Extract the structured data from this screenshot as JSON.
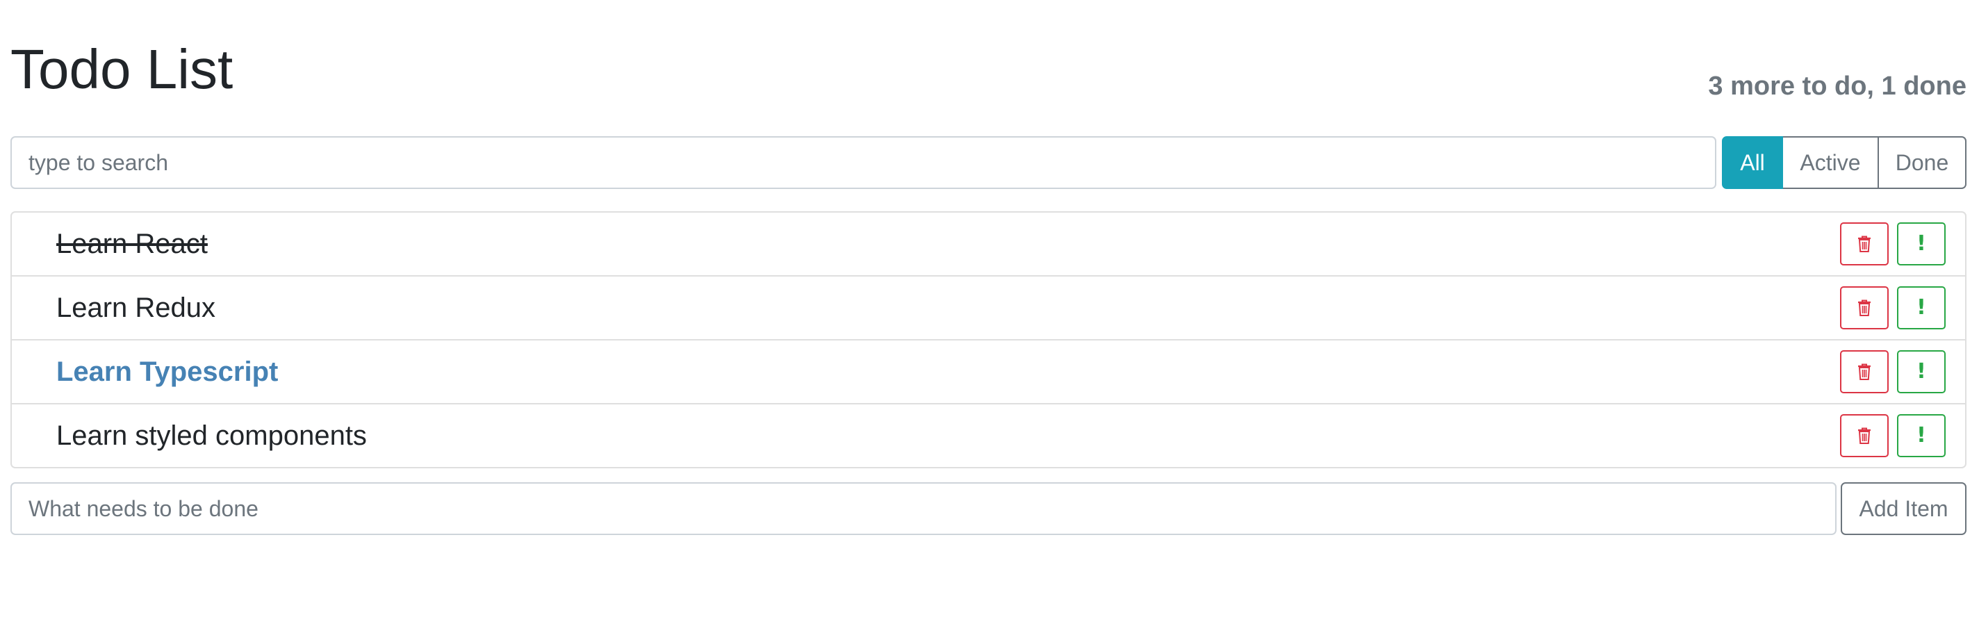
{
  "header": {
    "title": "Todo List",
    "counter": "3 more to do, 1 done"
  },
  "search": {
    "placeholder": "type to search",
    "value": ""
  },
  "filters": [
    {
      "label": "All",
      "selected": true
    },
    {
      "label": "Active",
      "selected": false
    },
    {
      "label": "Done",
      "selected": false
    }
  ],
  "todos": [
    {
      "label": "Learn React",
      "done": true,
      "important": false
    },
    {
      "label": "Learn Redux",
      "done": false,
      "important": false
    },
    {
      "label": "Learn Typescript",
      "done": false,
      "important": true
    },
    {
      "label": "Learn styled components",
      "done": false,
      "important": false
    }
  ],
  "item_actions": {
    "delete_icon": "trash-icon",
    "important_icon": "exclamation-icon",
    "important_glyph": "!"
  },
  "add_item": {
    "placeholder": "What needs to be done",
    "value": "",
    "button_label": "Add Item"
  },
  "colors": {
    "accent": "#17a2b8",
    "danger": "#dc3545",
    "success": "#28a745",
    "important_text": "#4682b4",
    "muted": "#6c757d"
  }
}
